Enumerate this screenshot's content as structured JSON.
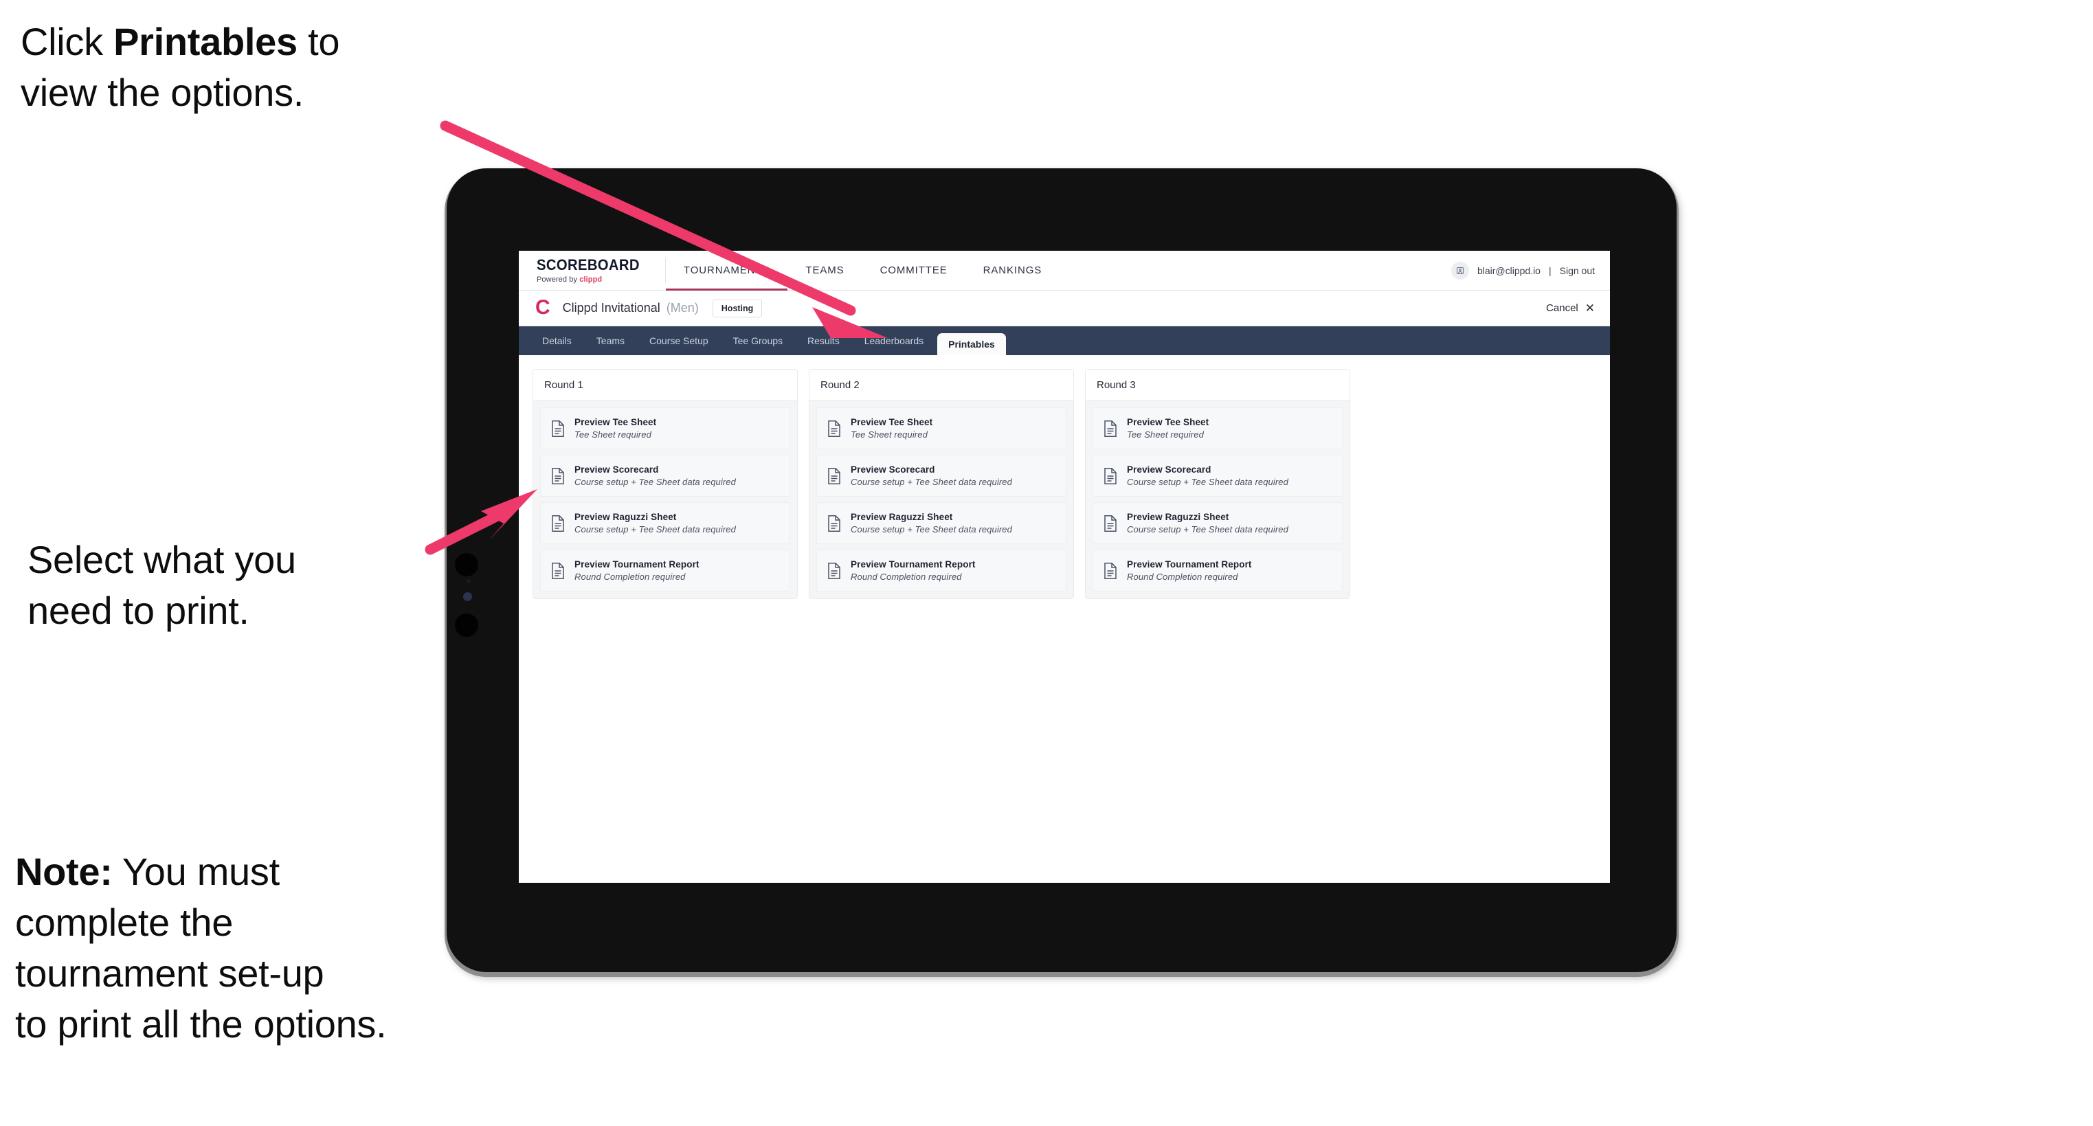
{
  "annotations": {
    "top": {
      "before": "Click ",
      "bold": "Printables",
      "after": " to\nview the options."
    },
    "middle": {
      "text": "Select what you\n need to print."
    },
    "note": {
      "bold": "Note:",
      "after": " You must\ncomplete the\ntournament set-up\nto print all the options."
    }
  },
  "colors": {
    "arrow_pink": "#ee3a6b",
    "brand_pink": "#e23a62",
    "tabbar_navy": "#32405a",
    "nav_active_underline": "#a9355a",
    "tournament_logo": "#d8275c"
  },
  "app": {
    "brand": {
      "title": "SCOREBOARD",
      "powered_prefix": "Powered by ",
      "powered_brand": "clippd"
    },
    "main_nav": [
      {
        "label": "TOURNAMENTS",
        "active": true
      },
      {
        "label": "TEAMS",
        "active": false
      },
      {
        "label": "COMMITTEE",
        "active": false
      },
      {
        "label": "RANKINGS",
        "active": false
      }
    ],
    "account": {
      "avatar_icon": "user-avatar-icon",
      "email": "blair@clippd.io",
      "separator": "|",
      "sign_out": "Sign out"
    },
    "tournament": {
      "logo_letter": "C",
      "name": "Clippd Invitational",
      "gender": "(Men)",
      "badge": "Hosting",
      "cancel_label": "Cancel",
      "cancel_icon": "close-icon"
    },
    "tabs": [
      {
        "label": "Details",
        "active": false
      },
      {
        "label": "Teams",
        "active": false
      },
      {
        "label": "Course Setup",
        "active": false
      },
      {
        "label": "Tee Groups",
        "active": false
      },
      {
        "label": "Results",
        "active": false
      },
      {
        "label": "Leaderboards",
        "active": false
      },
      {
        "label": "Printables",
        "active": true
      }
    ],
    "rounds": [
      {
        "title": "Round 1",
        "items": [
          {
            "title": "Preview Tee Sheet",
            "subtitle": "Tee Sheet required"
          },
          {
            "title": "Preview Scorecard",
            "subtitle": "Course setup + Tee Sheet data required"
          },
          {
            "title": "Preview Raguzzi Sheet",
            "subtitle": "Course setup + Tee Sheet data required"
          },
          {
            "title": "Preview Tournament Report",
            "subtitle": "Round Completion required"
          }
        ]
      },
      {
        "title": "Round 2",
        "items": [
          {
            "title": "Preview Tee Sheet",
            "subtitle": "Tee Sheet required"
          },
          {
            "title": "Preview Scorecard",
            "subtitle": "Course setup + Tee Sheet data required"
          },
          {
            "title": "Preview Raguzzi Sheet",
            "subtitle": "Course setup + Tee Sheet data required"
          },
          {
            "title": "Preview Tournament Report",
            "subtitle": "Round Completion required"
          }
        ]
      },
      {
        "title": "Round 3",
        "items": [
          {
            "title": "Preview Tee Sheet",
            "subtitle": "Tee Sheet required"
          },
          {
            "title": "Preview Scorecard",
            "subtitle": "Course setup + Tee Sheet data required"
          },
          {
            "title": "Preview Raguzzi Sheet",
            "subtitle": "Course setup + Tee Sheet data required"
          },
          {
            "title": "Preview Tournament Report",
            "subtitle": "Round Completion required"
          }
        ]
      }
    ]
  }
}
